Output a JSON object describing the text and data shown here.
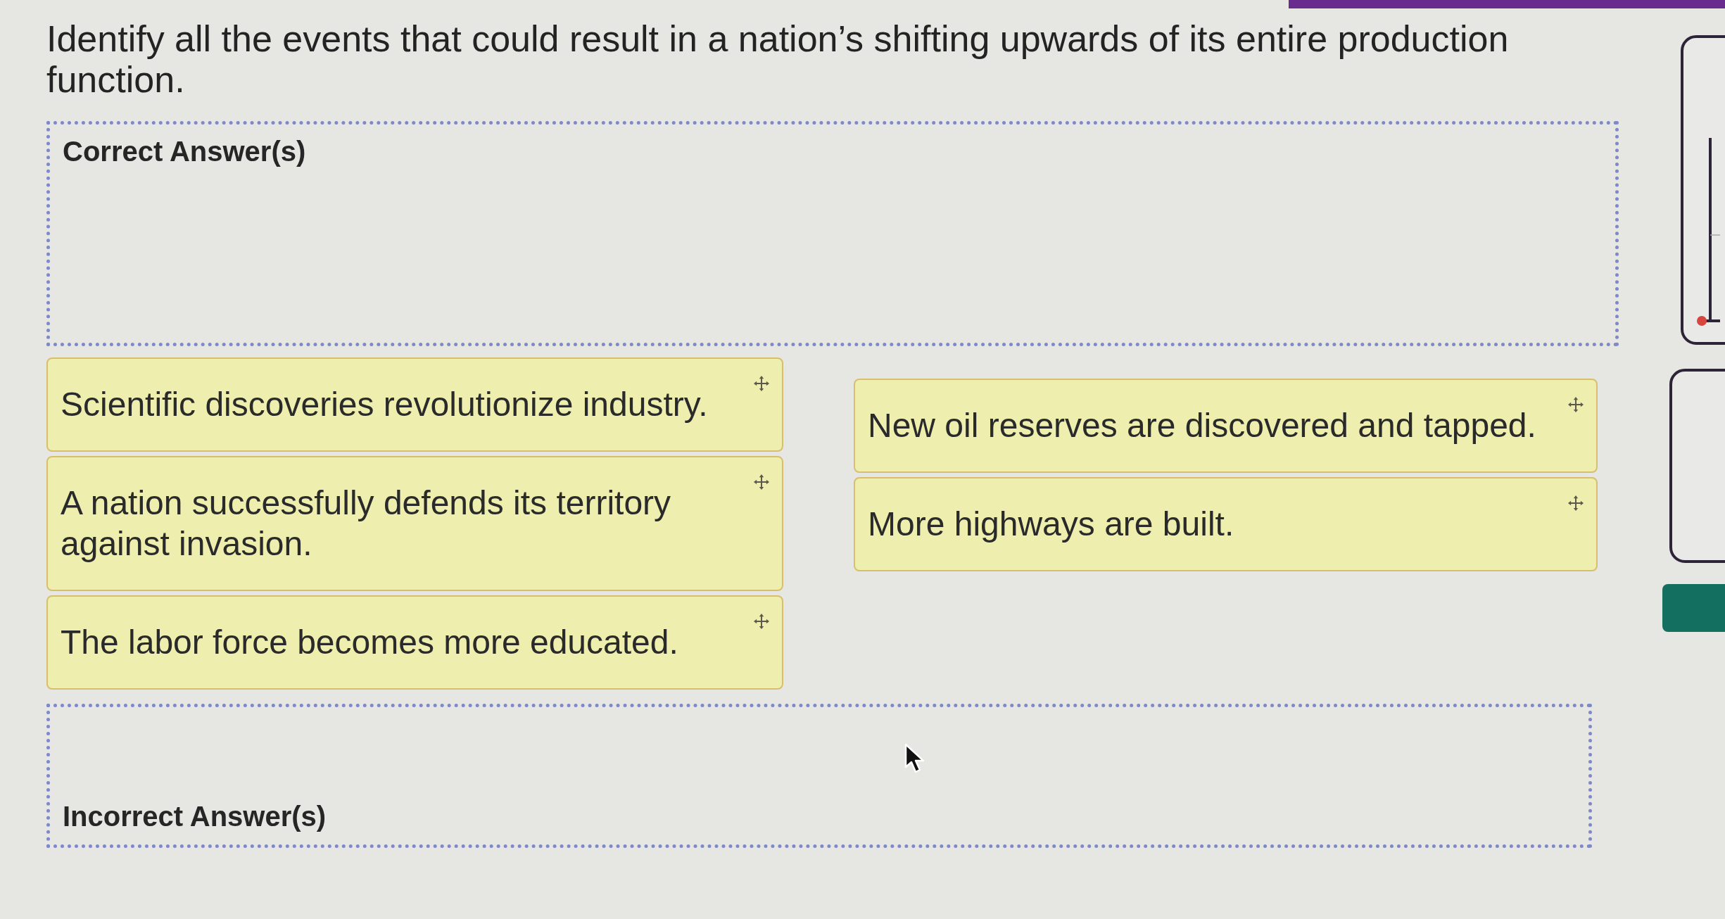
{
  "question": "Identify all the events that could result in a nation’s shifting upwards of its entire production function.",
  "correct_zone": {
    "label": "Correct Answer(s)"
  },
  "answer_bank": {
    "columns": [
      {
        "items": [
          {
            "text": "Scientific discoveries revolutionize industry."
          },
          {
            "text": "A nation successfully defends its territory against invasion."
          },
          {
            "text": "The labor force becomes more educated."
          }
        ]
      },
      {
        "items": [
          {
            "text": "New oil reserves are discovered and tapped."
          },
          {
            "text": "More highways are built."
          }
        ]
      }
    ]
  },
  "incorrect_zone": {
    "label": "Incorrect Answer(s)"
  }
}
